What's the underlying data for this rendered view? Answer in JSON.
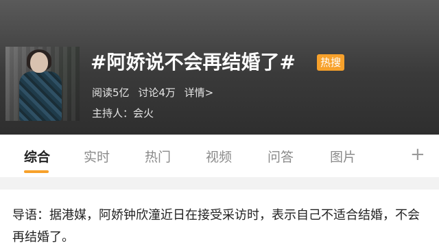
{
  "topic": {
    "title": "#阿娇说不会再结婚了#",
    "badge": "热搜",
    "stats": {
      "reads": "阅读5亿",
      "discussions": "讨论4万",
      "details": "详情>"
    },
    "host": "主持人：会火"
  },
  "tabs": [
    "综合",
    "实时",
    "热门",
    "视频",
    "问答",
    "图片"
  ],
  "tab_active": "综合",
  "more_icon": "plus-icon",
  "article": {
    "lead": "导语：据港媒，阿娇钟欣潼近日在接受采访时，表示自己不适合结婚，不会再结婚了。"
  },
  "colors": {
    "accent": "#f7a12b",
    "header_bg": "#3a3a3a"
  }
}
